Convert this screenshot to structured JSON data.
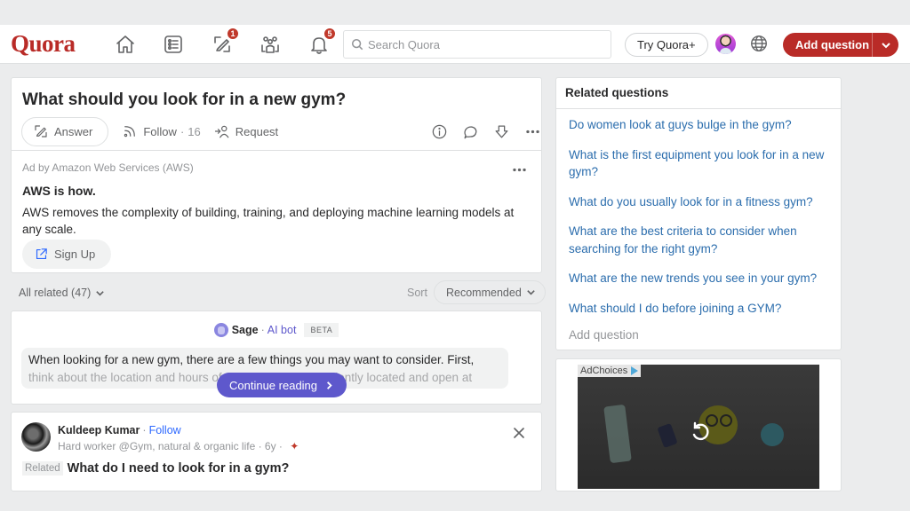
{
  "header": {
    "logo": "Quora",
    "nav": [
      {
        "name": "home",
        "icon": "home-icon",
        "badge": null
      },
      {
        "name": "following",
        "icon": "list-icon",
        "badge": null
      },
      {
        "name": "answer",
        "icon": "edit-icon",
        "badge": "1"
      },
      {
        "name": "spaces",
        "icon": "people-icon",
        "badge": null
      },
      {
        "name": "notifications",
        "icon": "bell-icon",
        "badge": "5"
      }
    ],
    "search_placeholder": "Search Quora",
    "try_plus": "Try Quora+",
    "add_question": "Add question"
  },
  "question": {
    "title": "What should you look for in a new gym?",
    "answer_label": "Answer",
    "follow_label": "Follow",
    "follow_count": "16",
    "request_label": "Request"
  },
  "ad": {
    "label": "Ad by Amazon Web Services (AWS)",
    "title": "AWS is how.",
    "body": "AWS removes the complexity of building, training, and deploying machine learning models at any scale.",
    "cta": "Sign Up"
  },
  "filter": {
    "all_related": "All related (47)",
    "sort_label": "Sort",
    "sort_value": "Recommended"
  },
  "sage": {
    "name": "Sage",
    "separator": "·",
    "role": "AI bot",
    "badge": "BETA",
    "line1": "When looking for a new gym, there are a few things you may want to consider. First,",
    "line2": "think about the location and hours of the gym. Is it conveniently located and open at",
    "continue": "Continue reading"
  },
  "answer_card": {
    "author": "Kuldeep Kumar",
    "separator": "·",
    "follow": "Follow",
    "credential": "Hard worker @Gym, natural & organic life · 6y ·",
    "spark": "✦",
    "related_tag": "Related",
    "related_question": "What do I need to look for in a gym?"
  },
  "related_questions": {
    "heading": "Related questions",
    "items": [
      "Do women look at guys bulge in the gym?",
      "What is the first equipment you look for in a new gym?",
      "What do you usually look for in a fitness gym?",
      "What are the best criteria to consider when searching for the right gym?",
      "What are the new trends you see in your gym?",
      "What should I do before joining a GYM?"
    ],
    "add_question": "Add question"
  },
  "side_ad": {
    "adchoices": "AdChoices"
  },
  "colors": {
    "brand": "#b92b27",
    "link": "#2b6dad",
    "sage": "#5e58cc",
    "follow_blue": "#2e69ff",
    "badge": "#c0392b"
  }
}
